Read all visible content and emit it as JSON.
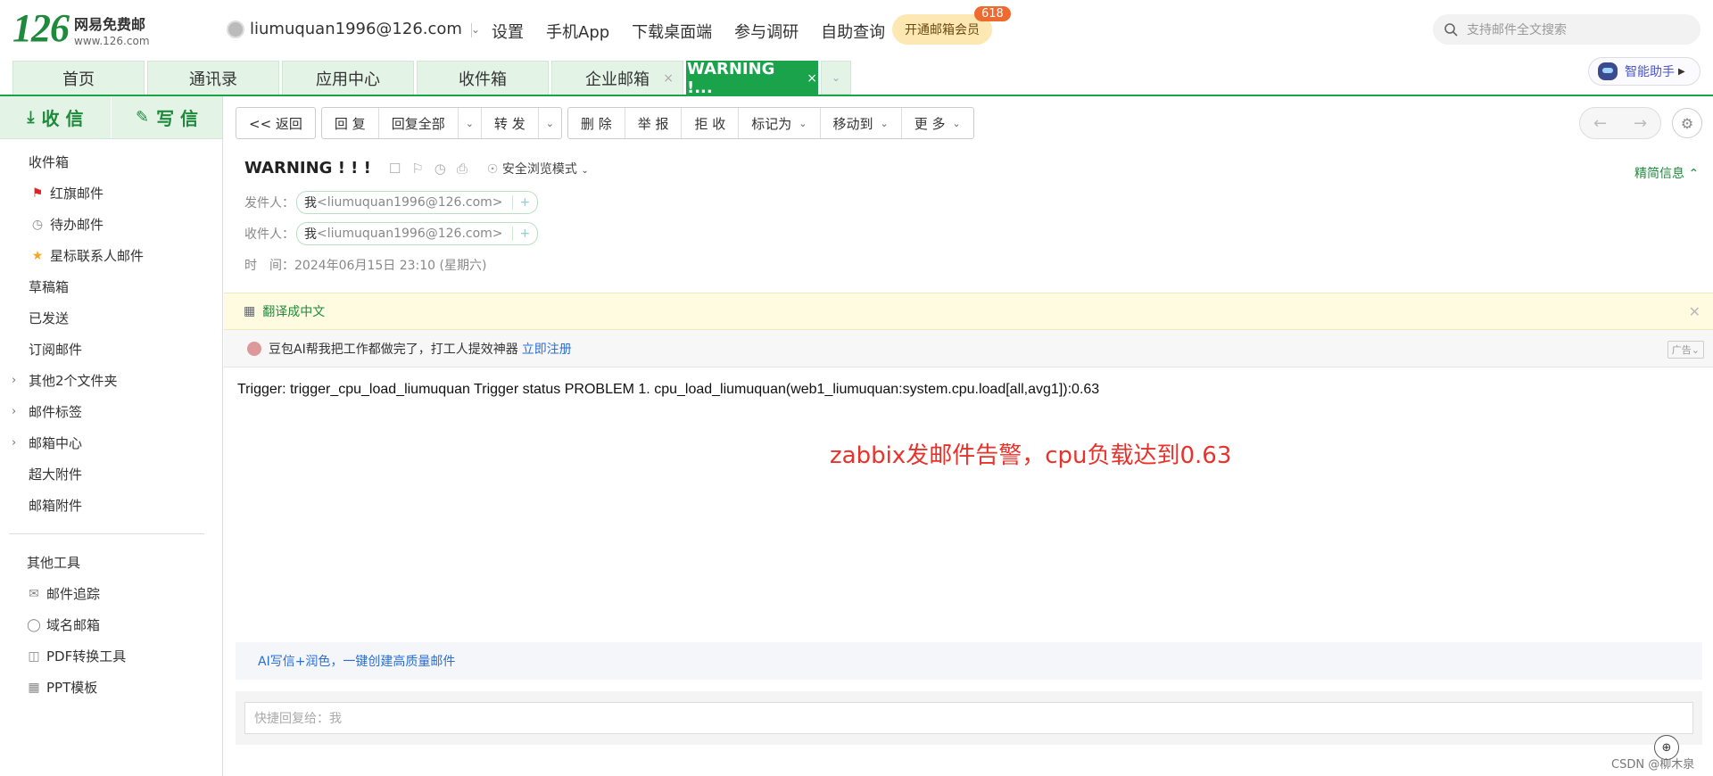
{
  "logo": {
    "num": "126",
    "line1": "网易免费邮",
    "line2": "www.126.com"
  },
  "account": {
    "email": "liumuquan1996@126.com"
  },
  "topnav": [
    "设置",
    "手机App",
    "下载桌面端",
    "参与调研",
    "自助查询"
  ],
  "vip": {
    "label": "开通邮箱会员",
    "badge": "618"
  },
  "search": {
    "placeholder": "支持邮件全文搜索"
  },
  "tabs": [
    {
      "label": "首页"
    },
    {
      "label": "通讯录"
    },
    {
      "label": "应用中心"
    },
    {
      "label": "收件箱"
    },
    {
      "label": "企业邮箱",
      "close": "×"
    },
    {
      "label": "WARNING !...",
      "close": "×"
    }
  ],
  "assistant": {
    "label": "智能助手"
  },
  "sidebar": {
    "receive": "收 信",
    "write": "写 信",
    "items": [
      {
        "label": "收件箱"
      },
      {
        "label": "红旗邮件"
      },
      {
        "label": "待办邮件"
      },
      {
        "label": "星标联系人邮件"
      },
      {
        "label": "草稿箱"
      },
      {
        "label": "已发送"
      },
      {
        "label": "订阅邮件"
      },
      {
        "label": "其他2个文件夹"
      },
      {
        "label": "邮件标签"
      },
      {
        "label": "邮箱中心"
      },
      {
        "label": "超大附件"
      },
      {
        "label": "邮箱附件"
      }
    ],
    "tools_title": "其他工具",
    "tools": [
      {
        "label": "邮件追踪"
      },
      {
        "label": "域名邮箱"
      },
      {
        "label": "PDF转换工具"
      },
      {
        "label": "PPT模板"
      }
    ]
  },
  "toolbar": {
    "back": "<< 返回",
    "reply": "回 复",
    "reply_all": "回复全部",
    "forward": "转 发",
    "delete": "删 除",
    "report": "举 报",
    "reject": "拒 收",
    "mark_as": "标记为",
    "move_to": "移动到",
    "more": "更 多"
  },
  "mail": {
    "subject": "WARNING ! ! !",
    "safe_mode": "安全浏览模式",
    "detail_toggle": "精简信息",
    "from_label": "发件人：",
    "from_name": "我",
    "from_addr": "<liumuquan1996@126.com>",
    "to_label": "收件人：",
    "to_name": "我",
    "to_addr": "<liumuquan1996@126.com>",
    "time_label": "时　间：",
    "time_value": "2024年06月15日 23:10 (星期六)",
    "body": "Trigger: trigger_cpu_load_liumuquan Trigger status PROBLEM 1. cpu_load_liumuquan(web1_liumuquan:system.cpu.load[all,avg1]):0.63",
    "annotation": "zabbix发邮件告警，cpu负载达到0.63"
  },
  "translate": {
    "label": "翻译成中文"
  },
  "ad": {
    "text": "豆包AI帮我把工作都做完了，打工人提效神器",
    "link": "立即注册",
    "tag": "广告"
  },
  "ai_bar": {
    "text": "AI写信+润色，一键创建高质量邮件"
  },
  "quick_reply": {
    "placeholder": "快捷回复给：我"
  },
  "watermark": "CSDN @柳木泉",
  "colors": {
    "brand_green": "#1aa34a",
    "annotation_red": "#e8322b",
    "link_blue": "#2a6fd6"
  }
}
